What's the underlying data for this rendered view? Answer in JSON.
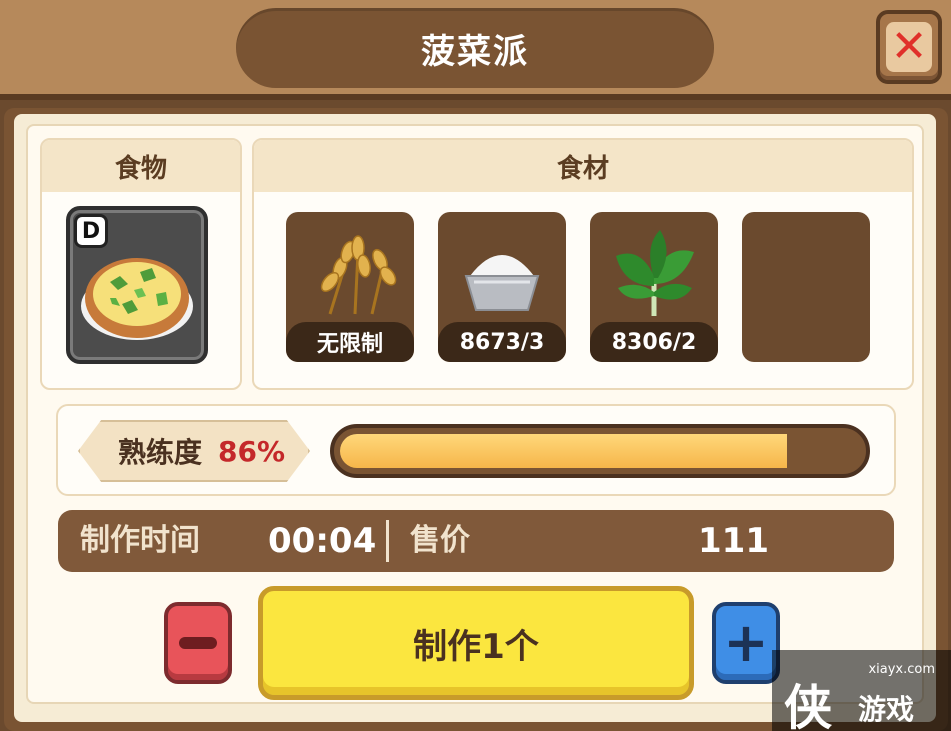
{
  "header": {
    "title": "菠菜派",
    "close_icon": "close-x-icon"
  },
  "food": {
    "header": "食物",
    "grade": "D",
    "item_icon": "spinach-pie-icon"
  },
  "ingredients": {
    "header": "食材",
    "slots": [
      {
        "icon": "wheat-icon",
        "label": "无限制"
      },
      {
        "icon": "flour-bowl-icon",
        "label": "8673/3"
      },
      {
        "icon": "spinach-icon",
        "label": "8306/2"
      },
      {
        "icon": "empty-slot",
        "label": ""
      }
    ]
  },
  "mastery": {
    "label": "熟练度",
    "value": "86%",
    "fraction": 0.86
  },
  "info": {
    "time_label": "制作时间",
    "time_value": "00:04",
    "price_label": "售价",
    "price_value": "111"
  },
  "actions": {
    "make_label": "制作1个",
    "minus_icon": "minus-icon",
    "plus_icon": "plus-icon"
  },
  "watermark": {
    "site": "xiayx.com",
    "brand_char": "侠",
    "brand_text": "游戏"
  },
  "colors": {
    "accent_yellow": "#fbe63f",
    "mastery_red": "#c4282a",
    "minus_red": "#e8545a",
    "plus_blue": "#3f8ee6",
    "panel_brown": "#7a5433"
  }
}
